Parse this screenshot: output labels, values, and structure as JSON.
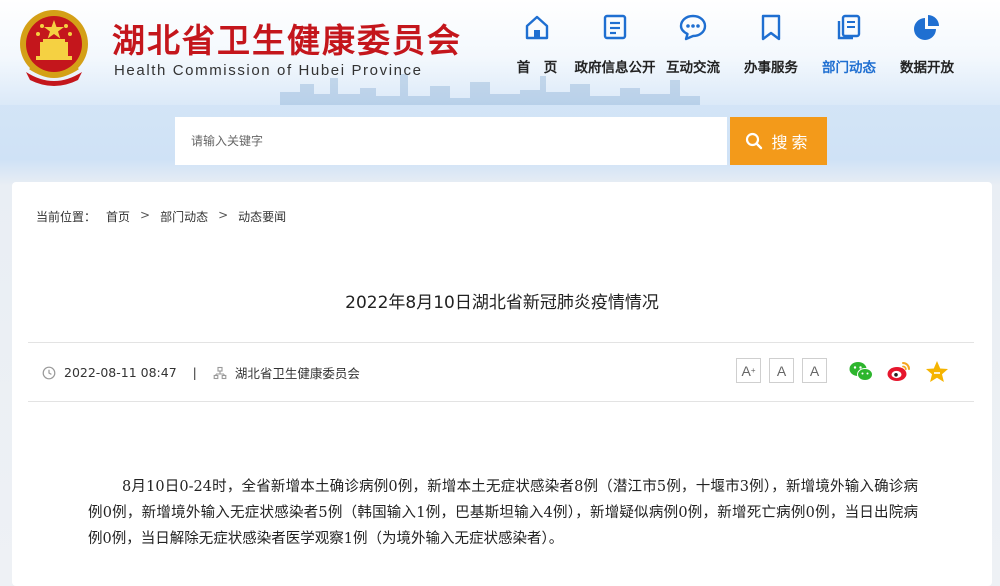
{
  "header": {
    "title": "湖北省卫生健康委员会",
    "subtitle": "Health Commission of Hubei Province"
  },
  "nav": [
    {
      "label": "首　页",
      "icon": "home-icon"
    },
    {
      "label": "政府信息公开",
      "icon": "document-icon"
    },
    {
      "label": "互动交流",
      "icon": "chat-icon"
    },
    {
      "label": "办事服务",
      "icon": "bookmark-icon"
    },
    {
      "label": "部门动态",
      "icon": "copy-icon",
      "active": true
    },
    {
      "label": "数据开放",
      "icon": "pie-chart-icon"
    }
  ],
  "search": {
    "placeholder": "请输入关键字",
    "button_label": "搜索"
  },
  "breadcrumb": {
    "prefix": "当前位置：",
    "items": [
      "首页",
      "部门动态",
      "动态要闻"
    ],
    "separator": ">"
  },
  "article": {
    "title": "2022年8月10日湖北省新冠肺炎疫情情况",
    "datetime": "2022-08-11 08:47",
    "divider": "|",
    "source": "湖北省卫生健康委员会",
    "body": "8月10日0-24时，全省新增本土确诊病例0例，新增本土无症状感染者8例（潜江市5例，十堰市3例），新增境外输入确诊病例0例，新增境外输入无症状感染者5例（韩国输入1例，巴基斯坦输入4例），新增疑似病例0例，新增死亡病例0例，当日出院病例0例，当日解除无症状感染者医学观察1例（为境外输入无症状感染者）。"
  },
  "font_controls": {
    "increase": "A",
    "increase_sup": "+",
    "normal": "A",
    "decrease": "A"
  },
  "share": [
    "wechat-icon",
    "weibo-icon",
    "favorite-star-icon"
  ],
  "colors": {
    "brand_red": "#c4161c",
    "nav_active": "#1f6fd1",
    "search_orange": "#f39a1a"
  }
}
